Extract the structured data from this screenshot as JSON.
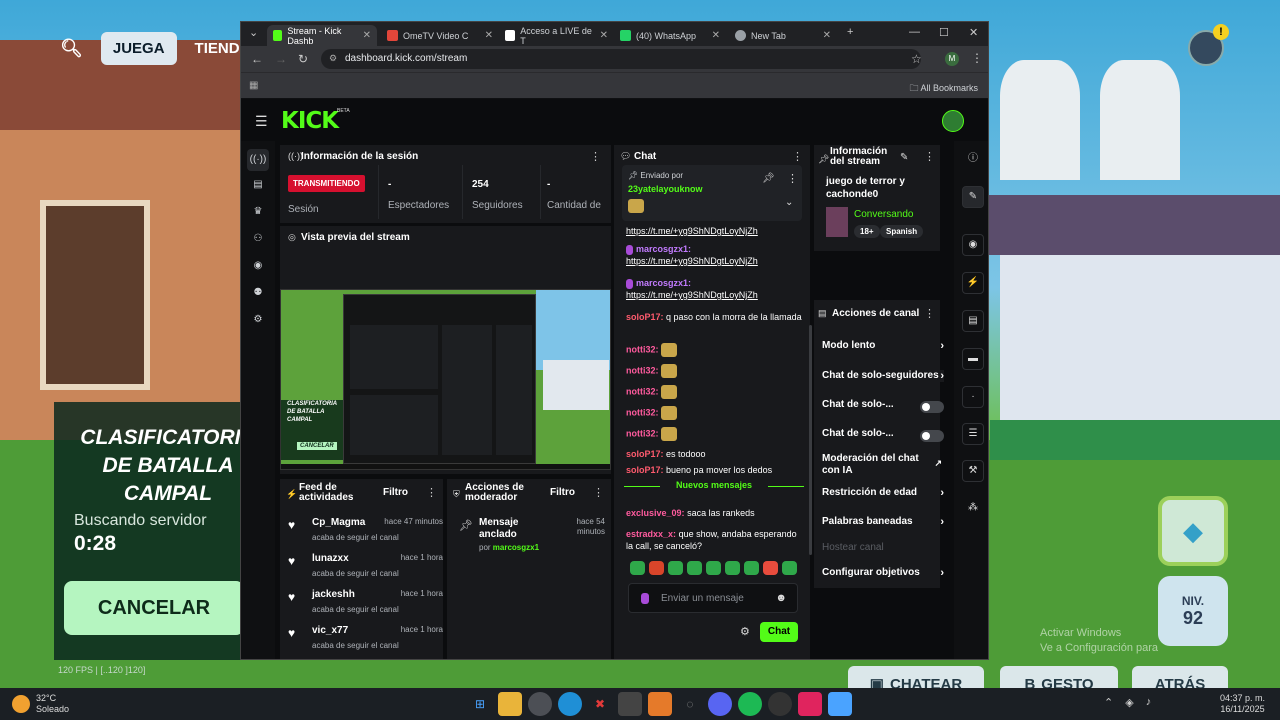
{
  "game": {
    "juega_label": "JUEGA",
    "tienda_label": "TIENDA",
    "queue_title": "CLASIFICATORIA DE BATALLA CAMPAL",
    "queue_status": "Buscando servidor",
    "queue_time": "0:28",
    "cancel_label": "CANCELAR",
    "fps_text": "120 FPS | [..120 ]120]",
    "level_label": "NIV.",
    "level_value": "92",
    "chat_label": "CHATEAR",
    "gesto_label": "GESTO",
    "back_label": "ATRÁS",
    "activate_text": "Activar Windows",
    "activate_sub": "Ve a Configuración para"
  },
  "browser": {
    "tabs": [
      {
        "label": "Stream - Kick Dashb",
        "color": "#53fc18",
        "active": true
      },
      {
        "label": "OmeTV Video C",
        "color": "#e2463a",
        "active": false
      },
      {
        "label": "Acceso a LIVE de T",
        "color": "#ffffff",
        "active": false
      },
      {
        "label": "(40) WhatsApp",
        "color": "#25d366",
        "active": false
      },
      {
        "label": "New Tab",
        "color": "#9aa0a6",
        "active": false
      }
    ],
    "url": "dashboard.kick.com/stream",
    "all_bookmarks": "All Bookmarks",
    "profile_initial": "M"
  },
  "kick": {
    "logo": "KICK",
    "beta": "BETA",
    "session": {
      "title": "Información de la sesión",
      "live_badge": "TRANSMITIENDO",
      "session_label": "Sesión",
      "stats": [
        {
          "value": "-",
          "label": "Espectadores"
        },
        {
          "value": "254",
          "label": "Seguidores"
        },
        {
          "value": "-",
          "label": "Cantidad de"
        }
      ]
    },
    "preview": {
      "title": "Vista previa del stream",
      "mini_title": "CLASIFICATORIA DE BATALLA CAMPAL",
      "mini_cancel": "CANCELAR"
    },
    "feed": {
      "title": "Feed de actividades",
      "filter": "Filtro",
      "items": [
        {
          "user": "Cp_Magma",
          "time": "hace 47 minutos",
          "action": "acaba de seguir el canal"
        },
        {
          "user": "lunazxx",
          "time": "hace 1 hora",
          "action": "acaba de seguir el canal"
        },
        {
          "user": "jackeshh",
          "time": "hace 1 hora",
          "action": "acaba de seguir el canal"
        },
        {
          "user": "vic_x77",
          "time": "hace 1 hora",
          "action": "acaba de seguir el canal"
        }
      ]
    },
    "modactions": {
      "title": "Acciones de moderador",
      "filter": "Filtro",
      "item_title": "Mensaje anclado",
      "item_time": "hace 54 minutos",
      "item_by_prefix": "por",
      "item_by": "marcosgzx1"
    },
    "chat": {
      "title": "Chat",
      "pinned_label": "Enviado por",
      "pinned_user": "23yatelayouknow",
      "messages": [
        {
          "user": "",
          "color": "#ffffff",
          "text": "https://t.me/+yg9ShNDgtLoyNjZh",
          "link": true
        },
        {
          "user": "marcosgzx1:",
          "color": "#c27bff",
          "text": "https://t.me/+yg9ShNDgtLoyNjZh",
          "link": true
        },
        {
          "user": "marcosgzx1:",
          "color": "#c27bff",
          "text": "https://t.me/+yg9ShNDgtLoyNjZh",
          "link": true
        },
        {
          "user": "soloP17:",
          "color": "#ff5b6e",
          "text": "q paso con la morra de la llamada",
          "link": false
        },
        {
          "user": "notti32:",
          "color": "#ff5b9e",
          "text": "",
          "link": false
        },
        {
          "user": "notti32:",
          "color": "#ff5b9e",
          "text": "",
          "link": false
        },
        {
          "user": "notti32:",
          "color": "#ff5b9e",
          "text": "",
          "link": false
        },
        {
          "user": "notti32:",
          "color": "#ff5b9e",
          "text": "",
          "link": false
        },
        {
          "user": "notti32:",
          "color": "#ff5b9e",
          "text": "",
          "link": false
        },
        {
          "user": "soloP17:",
          "color": "#ff5b6e",
          "text": "es todooo",
          "link": false
        },
        {
          "user": "soloP17:",
          "color": "#ff5b6e",
          "text": "bueno pa mover los dedos",
          "link": false
        }
      ],
      "new_messages": "Nuevos mensajes",
      "after_messages": [
        {
          "user": "exclusive_09:",
          "color": "#ff5b9e",
          "text": "saca las rankeds"
        },
        {
          "user": "estradxx_x:",
          "color": "#ff5b9e",
          "text": "que show, andaba esperando la call, se canceló?"
        }
      ],
      "input_placeholder": "Enviar un mensaje",
      "send_label": "Chat"
    },
    "stream_info": {
      "title": "Información del stream",
      "stream_title": "juego de terror y cachonde0",
      "category": "Conversando",
      "tags": [
        "18+",
        "Spanish"
      ]
    },
    "channel_actions": {
      "title": "Acciones de canal",
      "items": [
        {
          "label": "Modo lento",
          "type": "chevron"
        },
        {
          "label": "Chat de solo-seguidores",
          "type": "chevron"
        },
        {
          "label": "Chat de solo-...",
          "type": "toggle"
        },
        {
          "label": "Chat de solo-...",
          "type": "toggle"
        },
        {
          "label": "Moderación del chat con IA",
          "type": "external"
        },
        {
          "label": "Restricción de edad",
          "type": "chevron"
        },
        {
          "label": "Palabras baneadas",
          "type": "chevron"
        },
        {
          "label": "Hostear canal",
          "type": "disabled"
        },
        {
          "label": "Configurar objetivos",
          "type": "chevron"
        }
      ]
    }
  },
  "taskbar": {
    "temp": "32°C",
    "weather": "Soleado",
    "time": "04:37 p. m.",
    "date": "16/11/2025"
  }
}
